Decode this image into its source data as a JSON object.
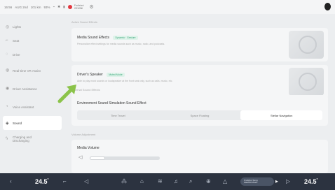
{
  "statusbar": {
    "time": "16:56",
    "date": "AUG 2nd",
    "mileage": "101 km",
    "range": "93%",
    "media_title": "Fruitshot",
    "media_artist": "GEMINI",
    "gear_icon": "gear-icon"
  },
  "sidebar": {
    "items": [
      {
        "label": "Lights",
        "icon": "lights-icon"
      },
      {
        "label": "Seat",
        "icon": "seat-icon"
      },
      {
        "label": "Drive",
        "icon": "car-icon"
      },
      {
        "label": "Real-time VR Assist",
        "icon": "vr-icon"
      },
      {
        "label": "Driver Assistance",
        "icon": "steering-icon"
      },
      {
        "label": "Voice Assistant",
        "icon": "voice-icon"
      },
      {
        "label": "Sound",
        "icon": "sound-icon"
      },
      {
        "label": "Charging and Discharging",
        "icon": "charging-icon"
      }
    ],
    "active_index": 6
  },
  "main": {
    "section1_title": "Active Sound Effects",
    "media_card": {
      "title": "Media Sound Effects",
      "badge": "Dynamic · Gesture",
      "desc": "Personalize effect settings for media sounds such as music, radio, and podcasts."
    },
    "speaker_card": {
      "title": "Driver's Speaker",
      "badge": "Muted Mode",
      "desc": "Able to play most sounds or loudspeaker at the front seat only, such as calls, music, etc."
    },
    "section2_title": "External Sound Effects",
    "env_card": {
      "title": "Environment Sound Simulation Sound Effect",
      "options": [
        "Time Travel",
        "Space Floating",
        "Stellar Navigation"
      ],
      "selected_index": 2
    },
    "section3_title": "Volume Adjustment",
    "volume_card": {
      "title": "Media Volume",
      "level_percent": 22
    }
  },
  "bottombar": {
    "temp_left": "24.5",
    "temp_right": "24.5",
    "temp_unit": "°",
    "media_title": "Fruitshot Song",
    "media_sub": "GEMINI Music"
  }
}
